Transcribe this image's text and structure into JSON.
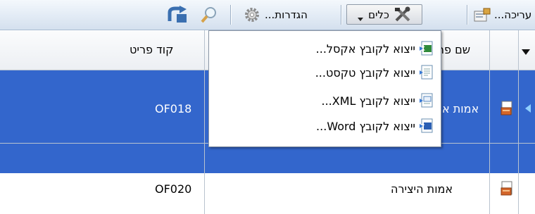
{
  "toolbar": {
    "edit_label": "עריכה...",
    "tools_label": "כלים",
    "settings_label": "הגדרות..."
  },
  "grid": {
    "col_name_header": "שם פר",
    "col_code_header": "קוד פריט",
    "rows": [
      {
        "name": "אמות א",
        "code": "OF018",
        "selected": true
      },
      {
        "name": "אמות היצירה",
        "code": "OF020",
        "selected": false
      }
    ]
  },
  "menu": {
    "items": [
      {
        "label": "ייצוא לקובץ אקסל...",
        "icon": "excel-file-icon"
      },
      {
        "label": "ייצוא לקובץ טקסט...",
        "icon": "text-file-icon"
      },
      {
        "label": "ייצוא לקובץ XML...",
        "icon": "xml-file-icon"
      },
      {
        "label": "ייצוא לקובץ Word...",
        "icon": "word-file-icon"
      }
    ]
  },
  "colors": {
    "selection": "#3366cc",
    "toolbar": "#dfe8f3"
  }
}
